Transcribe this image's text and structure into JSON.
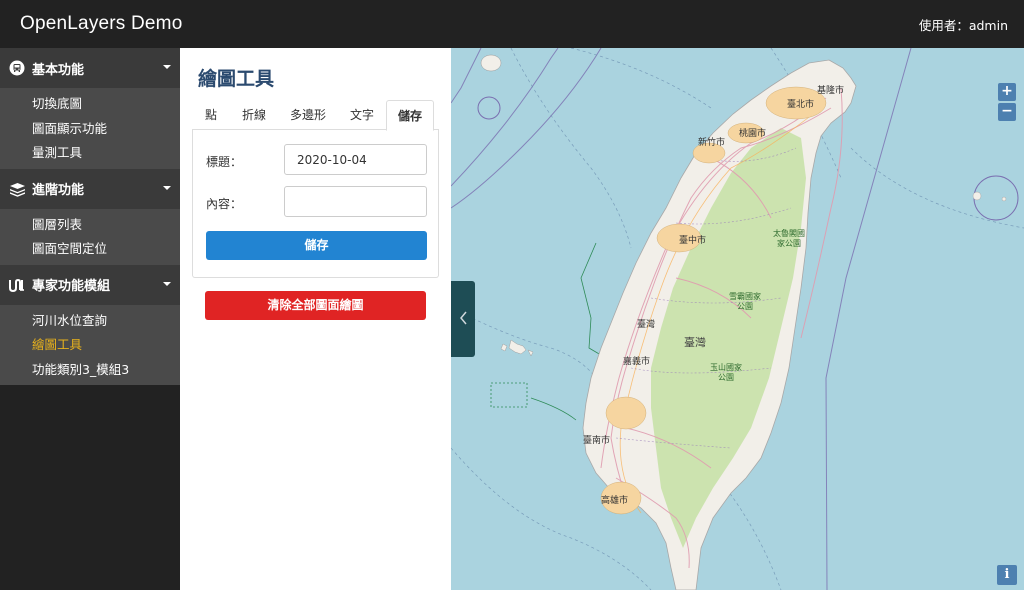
{
  "app": {
    "brand": "OpenLayers Demo",
    "user_label": "使用者：admin"
  },
  "sidebar": {
    "groups": [
      {
        "label": "基本功能",
        "icon": "bus-icon",
        "items": [
          "切換底圖",
          "圖面顯示功能",
          "量測工具"
        ]
      },
      {
        "label": "進階功能",
        "icon": "layers-icon",
        "items": [
          "圖層列表",
          "圖面空間定位"
        ]
      },
      {
        "label": "專家功能模組",
        "icon": "expert-icon",
        "items": [
          "河川水位查詢",
          "繪圖工具",
          "功能類別3_模組3"
        ]
      }
    ],
    "active_item": "繪圖工具",
    "active_color": "#e8b21c"
  },
  "panel": {
    "title": "繪圖工具",
    "tabs": [
      "點",
      "折線",
      "多邊形",
      "文字",
      "儲存"
    ],
    "active_tab": "儲存",
    "form": {
      "title_label": "標題：",
      "title_value": "2020-10-04",
      "content_label": "內容：",
      "content_value": "",
      "save_label": "儲存"
    },
    "clear_label": "清除全部圖面繪圖"
  },
  "map": {
    "zoom_in": "+",
    "zoom_out": "−",
    "info": "i",
    "labels": {
      "keelung": "基隆市",
      "taipei": "臺北市",
      "taoyuan": "桃園市",
      "hsinchu": "新竹市",
      "taichung": "臺中市",
      "taroko": [
        "太魯閣國",
        "家公園"
      ],
      "sheipa": [
        "雪霸國家",
        "公園"
      ],
      "penghu": "臺灣",
      "taiwan": "臺灣",
      "chiayi": "嘉義市",
      "yushan": [
        "玉山國家",
        "公園"
      ],
      "tainan": "臺南市",
      "kaohsiung": "高雄市"
    },
    "colors": {
      "water": "#aad3df",
      "land": "#f2efe9",
      "forest": "#c8e1a8",
      "accent": "#2284d2",
      "danger": "#e02424"
    }
  }
}
